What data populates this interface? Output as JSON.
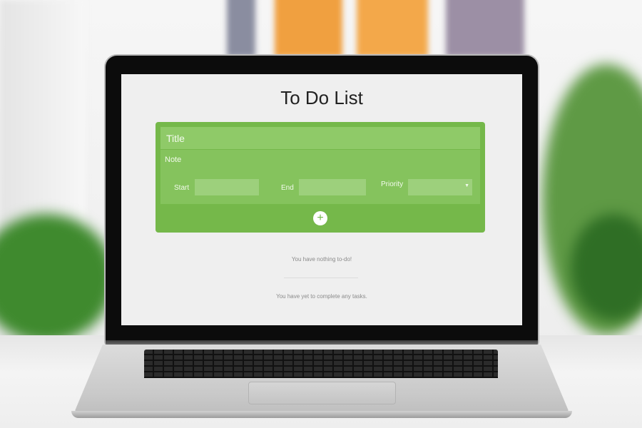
{
  "app": {
    "title": "To Do List"
  },
  "form": {
    "title_placeholder": "Title",
    "note_label": "Note",
    "start_label": "Start",
    "end_label": "End",
    "priority_label": "Priority",
    "select_arrow": "▼",
    "add_label": "+"
  },
  "messages": {
    "todo_empty": "You have nothing to-do!",
    "completed_empty": "You have yet to complete any tasks."
  },
  "colors": {
    "accent": "#75b84a",
    "screen_bg": "#efefef"
  }
}
